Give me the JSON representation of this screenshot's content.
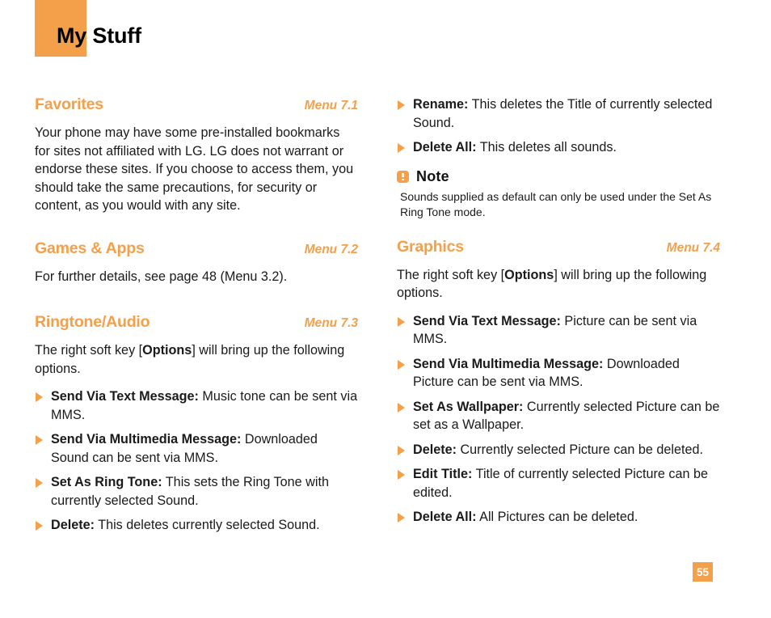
{
  "header": {
    "title": "My Stuff",
    "accent_color": "#f4a04a"
  },
  "page_number": "55",
  "left_column": {
    "sections": [
      {
        "title": "Favorites",
        "menu": "Menu 7.1",
        "paragraph": "Your phone may have some pre-installed bookmarks for sites not affiliated with LG. LG does not warrant or endorse these sites. If you choose to access them, you should take the same precautions, for security or content, as you would with any site."
      },
      {
        "title": "Games & Apps",
        "menu": "Menu 7.2",
        "paragraph": "For further details, see page 48 (Menu 3.2)."
      },
      {
        "title": "Ringtone/Audio",
        "menu": "Menu 7.3",
        "intro_before": "The right soft key [",
        "intro_bold": "Options",
        "intro_after": "] will bring up the following options.",
        "bullets": [
          {
            "term": "Send Via Text Message:",
            "desc": " Music tone can be sent via MMS."
          },
          {
            "term": "Send Via Multimedia Message:",
            "desc": " Downloaded Sound can be sent via MMS."
          },
          {
            "term": "Set As Ring Tone:",
            "desc": " This sets the Ring Tone with currently selected Sound."
          },
          {
            "term": "Delete:",
            "desc": " This deletes currently selected Sound."
          }
        ]
      }
    ]
  },
  "right_column": {
    "continued_bullets": [
      {
        "term": "Rename:",
        "desc": " This deletes the Title of currently selected Sound."
      },
      {
        "term": "Delete All:",
        "desc": " This deletes all sounds."
      }
    ],
    "note": {
      "icon": "exclamation-icon",
      "title": "Note",
      "body": "Sounds supplied as default can only be used under the Set As Ring Tone mode."
    },
    "sections": [
      {
        "title": "Graphics",
        "menu": "Menu 7.4",
        "intro_before": "The right soft key [",
        "intro_bold": "Options",
        "intro_after": "] will bring up the following options.",
        "bullets": [
          {
            "term": "Send Via Text Message:",
            "desc": " Picture can be sent via MMS."
          },
          {
            "term": "Send Via Multimedia Message:",
            "desc": " Downloaded Picture can be sent via MMS."
          },
          {
            "term": "Set As Wallpaper:",
            "desc": " Currently selected Picture can be set as a Wallpaper."
          },
          {
            "term": "Delete:",
            "desc": " Currently selected Picture can be deleted."
          },
          {
            "term": "Edit Title:",
            "desc": " Title of currently selected Picture can be edited."
          },
          {
            "term": "Delete All:",
            "desc": " All Pictures can be deleted."
          }
        ]
      }
    ]
  }
}
